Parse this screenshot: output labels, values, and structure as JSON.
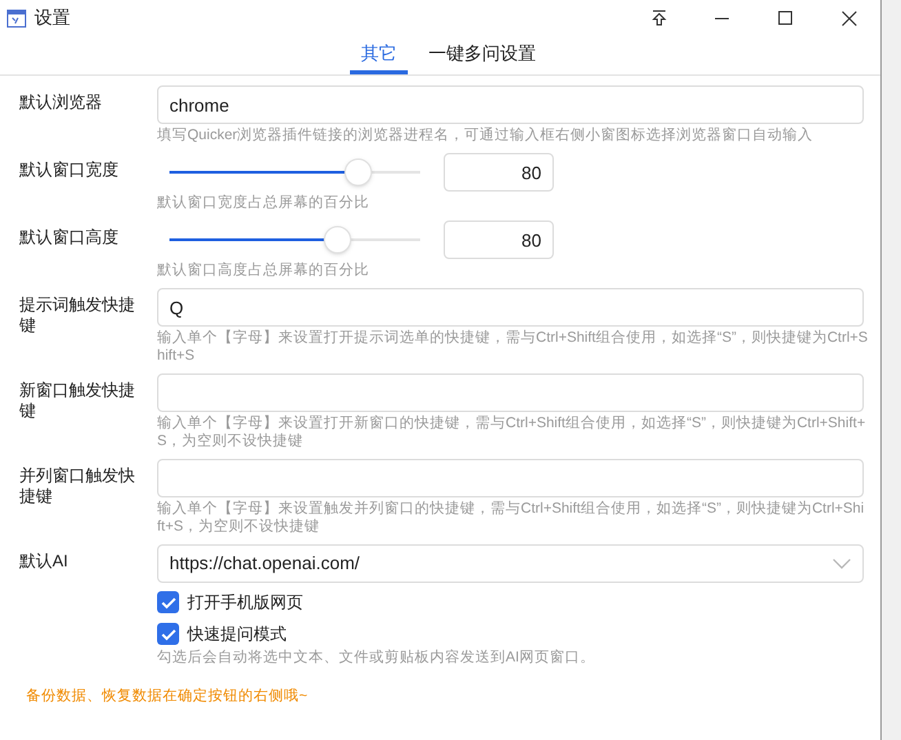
{
  "window": {
    "title": "设置"
  },
  "tabs": [
    {
      "label": "其它",
      "selected": true
    },
    {
      "label": "一键多问设置",
      "selected": false
    }
  ],
  "rows": [
    {
      "kind": "text",
      "label": "默认浏览器",
      "value": "chrome",
      "hint": "填写Quicker浏览器插件链接的浏览器进程名，可通过输入框右侧小窗图标选择浏览器窗口自动输入"
    },
    {
      "kind": "slider",
      "label": "默认窗口宽度",
      "level": 0.75,
      "value": "80",
      "hint": "默认窗口宽度占总屏幕的百分比"
    },
    {
      "kind": "slider",
      "label": "默认窗口高度",
      "level": 0.67,
      "value": "80",
      "hint": "默认窗口高度占总屏幕的百分比"
    },
    {
      "kind": "text",
      "label": "提示词触发快捷键",
      "value": "Q",
      "hint": "输入单个【字母】来设置打开提示词选单的快捷键，需与Ctrl+Shift组合使用，如选择“S”，则快捷键为Ctrl+Shift+S"
    },
    {
      "kind": "text",
      "label": "新窗口触发快捷键",
      "hint": "输入单个【字母】来设置打开新窗口的快捷键，需与Ctrl+Shift组合使用，如选择“S”，则快捷键为Ctrl+Shift+S，为空则不设快捷键"
    },
    {
      "kind": "text",
      "label": "并列窗口触发快捷键",
      "hint": "输入单个【字母】来设置触发并列窗口的快捷键，需与Ctrl+Shift组合使用，如选择“S”，则快捷键为Ctrl+Shift+S，为空则不设快捷键"
    },
    {
      "kind": "select",
      "label": "默认AI",
      "value": "https://chat.openai.com/"
    },
    {
      "kind": "checkbox",
      "label": "打开手机版网页",
      "checked": true
    },
    {
      "kind": "checkbox",
      "label": "快速提问模式",
      "checked": true,
      "hint": "勾选后会自动将选中文本、文件或剪贴板内容发送到AI网页窗口。"
    }
  ],
  "note": "备份数据、恢复数据在确定按钮的右侧哦~"
}
